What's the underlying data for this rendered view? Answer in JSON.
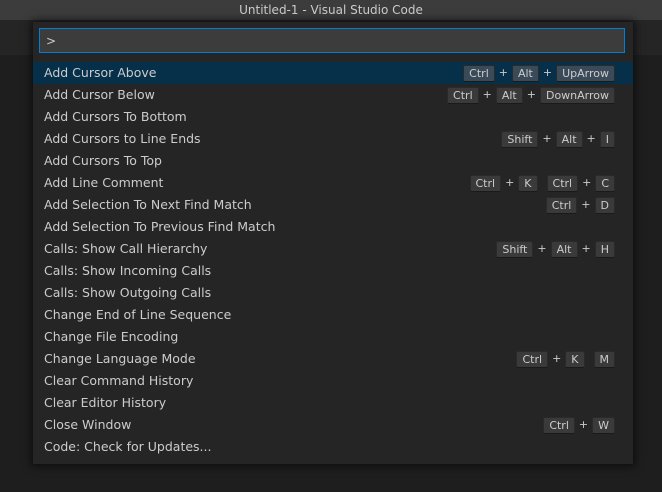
{
  "window": {
    "title": "Untitled-1 - Visual Studio Code"
  },
  "palette": {
    "input_value": ">",
    "selected_index": 0,
    "items": [
      {
        "label": "Add Cursor Above",
        "keys": [
          [
            "Ctrl",
            "Alt",
            "UpArrow"
          ]
        ]
      },
      {
        "label": "Add Cursor Below",
        "keys": [
          [
            "Ctrl",
            "Alt",
            "DownArrow"
          ]
        ]
      },
      {
        "label": "Add Cursors To Bottom",
        "keys": []
      },
      {
        "label": "Add Cursors to Line Ends",
        "keys": [
          [
            "Shift",
            "Alt",
            "I"
          ]
        ]
      },
      {
        "label": "Add Cursors To Top",
        "keys": []
      },
      {
        "label": "Add Line Comment",
        "keys": [
          [
            "Ctrl",
            "K"
          ],
          [
            "Ctrl",
            "C"
          ]
        ]
      },
      {
        "label": "Add Selection To Next Find Match",
        "keys": [
          [
            "Ctrl",
            "D"
          ]
        ]
      },
      {
        "label": "Add Selection To Previous Find Match",
        "keys": []
      },
      {
        "label": "Calls: Show Call Hierarchy",
        "keys": [
          [
            "Shift",
            "Alt",
            "H"
          ]
        ]
      },
      {
        "label": "Calls: Show Incoming Calls",
        "keys": []
      },
      {
        "label": "Calls: Show Outgoing Calls",
        "keys": []
      },
      {
        "label": "Change End of Line Sequence",
        "keys": []
      },
      {
        "label": "Change File Encoding",
        "keys": []
      },
      {
        "label": "Change Language Mode",
        "keys": [
          [
            "Ctrl",
            "K"
          ],
          [
            "M"
          ]
        ]
      },
      {
        "label": "Clear Command History",
        "keys": []
      },
      {
        "label": "Clear Editor History",
        "keys": []
      },
      {
        "label": "Close Window",
        "keys": [
          [
            "Ctrl",
            "W"
          ]
        ]
      },
      {
        "label": "Code: Check for Updates...",
        "keys": []
      }
    ]
  }
}
